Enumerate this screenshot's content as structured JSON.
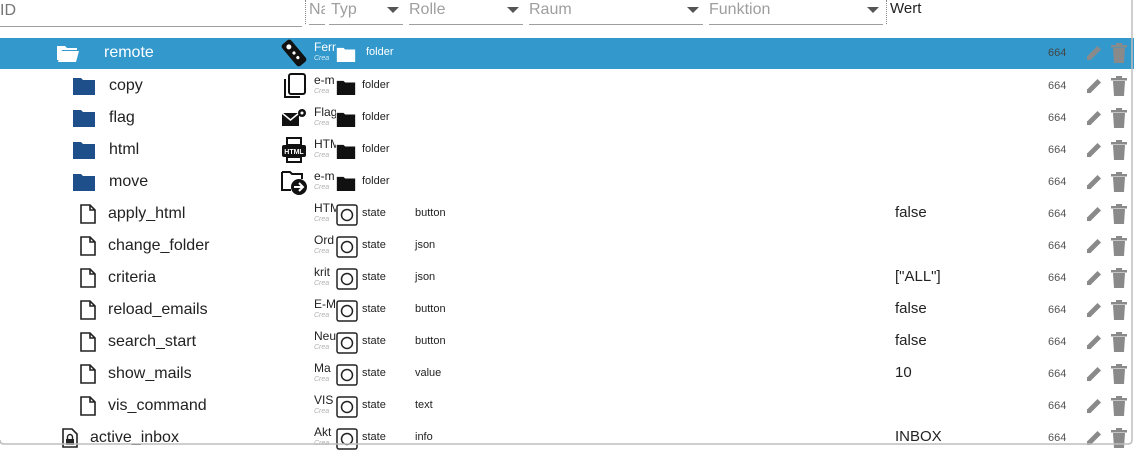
{
  "header": {
    "id_placeholder": "ID",
    "name_label": "Na",
    "typ": "Typ",
    "rolle": "Rolle",
    "raum": "Raum",
    "funktion": "Funktion",
    "wert": "Wert"
  },
  "rows": [
    {
      "label": "remote",
      "icon": "folder-open-icon",
      "name": "Fern",
      "sub": "Crea",
      "fnicon": "remote-control-icon",
      "typ": "folder",
      "rolle": "",
      "value": "",
      "perm": "664",
      "selected": true
    },
    {
      "label": "copy",
      "icon": "folder-icon",
      "name": "e-m",
      "sub": "Crea",
      "fnicon": "copy-icon",
      "typ": "folder",
      "rolle": "",
      "value": "",
      "perm": "664"
    },
    {
      "label": "flag",
      "icon": "folder-icon",
      "name": "Flag",
      "sub": "Crea",
      "fnicon": "mail-flag-icon",
      "typ": "folder",
      "rolle": "",
      "value": "",
      "perm": "664"
    },
    {
      "label": "html",
      "icon": "folder-icon",
      "name": "HTM",
      "sub": "Crea",
      "fnicon": "html-print-icon",
      "typ": "folder",
      "rolle": "",
      "value": "",
      "perm": "664"
    },
    {
      "label": "move",
      "icon": "folder-icon",
      "name": "e-m",
      "sub": "Crea",
      "fnicon": "folder-move-icon",
      "typ": "folder",
      "rolle": "",
      "value": "",
      "perm": "664"
    },
    {
      "label": "apply_html",
      "icon": "file-icon",
      "name": "HTM",
      "sub": "Crea",
      "typ": "state",
      "rolle": "button",
      "value": "false",
      "perm": "664"
    },
    {
      "label": "change_folder",
      "icon": "file-icon",
      "name": "Ord",
      "sub": "Crea",
      "typ": "state",
      "rolle": "json",
      "value": "",
      "perm": "664"
    },
    {
      "label": "criteria",
      "icon": "file-icon",
      "name": "krit",
      "sub": "Crea",
      "typ": "state",
      "rolle": "json",
      "value": "[\"ALL\"]",
      "perm": "664"
    },
    {
      "label": "reload_emails",
      "icon": "file-icon",
      "name": "E-M",
      "sub": "Crea",
      "typ": "state",
      "rolle": "button",
      "value": "false",
      "perm": "664"
    },
    {
      "label": "search_start",
      "icon": "file-icon",
      "name": "Neu",
      "sub": "Crea",
      "typ": "state",
      "rolle": "button",
      "value": "false",
      "perm": "664"
    },
    {
      "label": "show_mails",
      "icon": "file-icon",
      "name": "Ma",
      "sub": "Crea",
      "typ": "state",
      "rolle": "value",
      "value": "10",
      "perm": "664"
    },
    {
      "label": "vis_command",
      "icon": "file-icon",
      "name": "VIS",
      "sub": "Crea",
      "typ": "state",
      "rolle": "text",
      "value": "",
      "perm": "664"
    },
    {
      "label": "active_inbox",
      "icon": "file-lock-icon",
      "name": "Akt",
      "sub": "Crea",
      "typ": "state",
      "rolle": "info",
      "value": "INBOX",
      "perm": "664"
    }
  ]
}
